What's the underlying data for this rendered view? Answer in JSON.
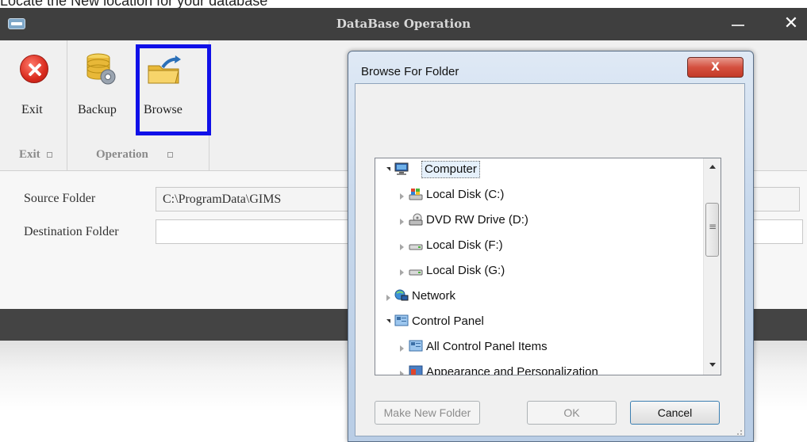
{
  "caption": {
    "text": "Locate the New location for your database"
  },
  "window": {
    "title": "DataBase Operation",
    "close_glyph": "✕"
  },
  "ribbon": {
    "buttons": [
      {
        "label": "Exit",
        "icon": "exit-icon"
      },
      {
        "label": "Backup",
        "icon": "database-gear-icon"
      },
      {
        "label": "Browse",
        "icon": "folder-export-icon"
      }
    ],
    "groups": [
      {
        "label": "Exit"
      },
      {
        "label": "Operation"
      }
    ]
  },
  "form": {
    "source_label": "Source Folder",
    "source_value": "C:\\ProgramData\\GIMS",
    "destination_label": "Destination Folder",
    "destination_value": ""
  },
  "dialog": {
    "title": "Browse For Folder",
    "close_glyph": "X",
    "tree": [
      {
        "label": "Computer",
        "icon": "computer-icon",
        "expanded": true,
        "selected": true
      },
      {
        "label": "Local Disk (C:)",
        "icon": "system-drive-icon"
      },
      {
        "label": "DVD RW Drive (D:)",
        "icon": "dvd-drive-icon"
      },
      {
        "label": "Local Disk (F:)",
        "icon": "hard-drive-icon"
      },
      {
        "label": "Local Disk (G:)",
        "icon": "hard-drive-icon"
      },
      {
        "label": "Network",
        "icon": "network-icon"
      },
      {
        "label": "Control Panel",
        "icon": "control-panel-icon",
        "expanded": true
      },
      {
        "label": "All Control Panel Items",
        "icon": "control-panel-icon"
      },
      {
        "label": "Appearance and Personalization",
        "icon": "appearance-icon"
      }
    ],
    "buttons": {
      "make_new_folder": "Make New Folder",
      "ok": "OK",
      "cancel": "Cancel"
    }
  },
  "colors": {
    "highlight_box": "#1010e8",
    "titlebar": "#3f3f3f"
  }
}
